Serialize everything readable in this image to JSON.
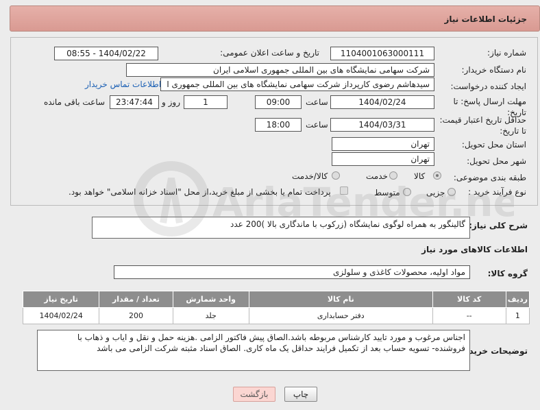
{
  "header": {
    "title": "جزئیات اطلاعات نیاز"
  },
  "form": {
    "need_number_label": "شماره نیاز:",
    "need_number": "1104001063000111",
    "announce_label": "تاریخ و ساعت اعلان عمومی:",
    "announce_value": "1404/02/22 - 08:55",
    "buyer_org_label": "نام دستگاه خریدار:",
    "buyer_org": "شرکت سهامی نمایشگاه های بین المللی جمهوری اسلامی ایران",
    "requester_label": "ایجاد کننده درخواست:",
    "requester": "سیدهاشم رضوی کارپرداز شرکت سهامی نمایشگاه های بین المللی جمهوری ا",
    "contact_link": "اطلاعات تماس خریدار",
    "deadline_label": "مهلت ارسال پاسخ: تا تاریخ:",
    "deadline_date": "1404/02/24",
    "time_label": "ساعت",
    "deadline_time": "09:00",
    "days_value": "1",
    "days_label": "روز و",
    "remaining_time": "23:47:44",
    "remaining_label": "ساعت باقی مانده",
    "validity_label": "حداقل تاریخ اعتبار قیمت: تا تاریخ:",
    "validity_date": "1404/03/31",
    "validity_time": "18:00",
    "province_label": "استان محل تحویل:",
    "province": "تهران",
    "city_label": "شهر محل تحویل:",
    "city": "تهران",
    "category_label": "طبقه بندی موضوعی:",
    "category_options": [
      "کالا",
      "خدمت",
      "کالا/خدمت"
    ],
    "process_label": "نوع فرآیند خرید :",
    "process_options": [
      "جزیی",
      "متوسط"
    ],
    "payment_note": "پرداخت تمام یا بخشی از مبلغ خرید،از محل \"اسناد خزانه اسلامی\" خواهد بود."
  },
  "summary": {
    "label": "شرح کلی نیاز:",
    "text": "گالینگور به همراه لوگوی نمایشگاه (زرکوب با ماندگاری بالا )200 عدد"
  },
  "goods": {
    "section_title": "اطلاعات کالاهای مورد نیاز",
    "group_label": "گروه کالا:",
    "group_value": "مواد اولیه، محصولات کاغذی و سلولزی",
    "columns": [
      "ردیف",
      "کد کالا",
      "نام کالا",
      "واحد شمارش",
      "تعداد / مقدار",
      "تاریخ نیاز"
    ],
    "rows": [
      [
        "1",
        "--",
        "دفتر حسابداری",
        "جلد",
        "200",
        "1404/02/24"
      ]
    ]
  },
  "buyer_notes": {
    "label": "توضیحات خریدار:",
    "text": "اجناس مرغوب و مورد تایید کارشناس  مربوطه باشد.الصاق پیش فاکتور الزامی .هزینه حمل و نقل و ایاب و ذهاب با فروشنده- تسویه حساب بعد از تکمیل فرایند حداقل یک ماه کاری. الصاق اسناد مثبته شرکت الزامی می باشد"
  },
  "buttons": {
    "print": "چاپ",
    "back": "بازگشت"
  },
  "watermark": {
    "text": "AriaTender.neT"
  }
}
